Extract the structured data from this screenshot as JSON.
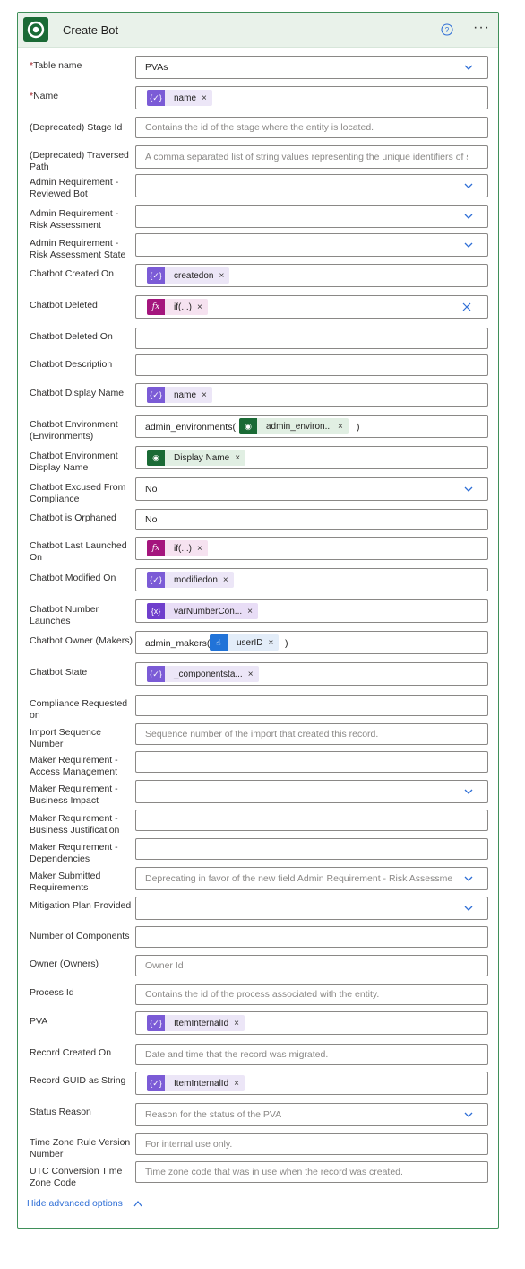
{
  "header": {
    "title": "Create Bot"
  },
  "icons": {
    "help": "help-circle-icon",
    "more": "more-horizontal-icon"
  },
  "colors": {
    "accent": "#1a6a35",
    "header_bg": "#e9f2ea",
    "link": "#2f6fd6"
  },
  "fields": {
    "table_name": {
      "label": "Table name",
      "value": "PVAs",
      "required": "*"
    },
    "name": {
      "label": "Name",
      "token": "name",
      "required": "*"
    },
    "deprecated_stage": {
      "label": "(Deprecated) Stage Id",
      "placeholder": "Contains the id of the stage where the entity is located."
    },
    "deprecated_path": {
      "label": "(Deprecated) Traversed Path",
      "placeholder": "A comma separated list of string values representing the unique identifiers of s"
    },
    "admin_reviewed": {
      "label": "Admin Requirement - Reviewed Bot"
    },
    "admin_risk": {
      "label": "Admin Requirement - Risk Assessment"
    },
    "admin_risk_state": {
      "label": "Admin Requirement - Risk Assessment State"
    },
    "created_on": {
      "label": "Chatbot Created On",
      "token": "createdon"
    },
    "deleted": {
      "label": "Chatbot Deleted",
      "token": "if(...)"
    },
    "deleted_on": {
      "label": "Chatbot Deleted On"
    },
    "description": {
      "label": "Chatbot Description"
    },
    "display_name": {
      "label": "Chatbot Display Name",
      "token": "name"
    },
    "environment": {
      "label": "Chatbot Environment (Environments)",
      "prefix": "admin_environments(",
      "token": "admin_environ...",
      "suffix": ")"
    },
    "env_display": {
      "label": "Chatbot Environment Display Name",
      "token": "Display Name"
    },
    "excused": {
      "label": "Chatbot Excused From Compliance",
      "value": "No"
    },
    "orphaned": {
      "label": "Chatbot is Orphaned",
      "value": "No"
    },
    "last_launched": {
      "label": "Chatbot Last Launched On",
      "token": "if(...)"
    },
    "modified_on": {
      "label": "Chatbot Modified On",
      "token": "modifiedon"
    },
    "launches": {
      "label": "Chatbot Number Launches",
      "token": "varNumberCon..."
    },
    "owner": {
      "label": "Chatbot Owner (Makers)",
      "prefix": "admin_makers(",
      "token": "userID",
      "suffix": ")"
    },
    "state": {
      "label": "Chatbot State",
      "token": "_componentsta..."
    },
    "compliance": {
      "label": "Compliance Requested on"
    },
    "import_seq": {
      "label": "Import Sequence Number",
      "placeholder": "Sequence number of the import that created this record."
    },
    "maker_access": {
      "label": "Maker Requirement - Access Management"
    },
    "maker_impact": {
      "label": "Maker Requirement - Business Impact"
    },
    "maker_justification": {
      "label": "Maker Requirement - Business Justification"
    },
    "maker_dependencies": {
      "label": "Maker Requirement - Dependencies"
    },
    "maker_submitted": {
      "label": "Maker Submitted Requirements",
      "placeholder": "Deprecating in favor of the new field Admin Requirement - Risk Assessme"
    },
    "mitigation": {
      "label": "Mitigation Plan Provided"
    },
    "components": {
      "label": "Number of Components"
    },
    "owner_id": {
      "label": "Owner (Owners)",
      "placeholder": "Owner Id"
    },
    "process": {
      "label": "Process Id",
      "placeholder": "Contains the id of the process associated with the entity."
    },
    "pva": {
      "label": "PVA",
      "token": "ItemInternalId"
    },
    "record_created": {
      "label": "Record Created On",
      "placeholder": "Date and time that the record was migrated."
    },
    "record_guid": {
      "label": "Record GUID as String",
      "token": "ItemInternalId"
    },
    "status_reason": {
      "label": "Status Reason",
      "placeholder": "Reason for the status of the PVA"
    },
    "tz_rule": {
      "label": "Time Zone Rule Version Number",
      "placeholder": "For internal use only."
    },
    "utc_tz": {
      "label": "UTC Conversion Time Zone Code",
      "placeholder": "Time zone code that was in use when the record was created."
    }
  },
  "footer": {
    "advanced_label": "Hide advanced options"
  }
}
